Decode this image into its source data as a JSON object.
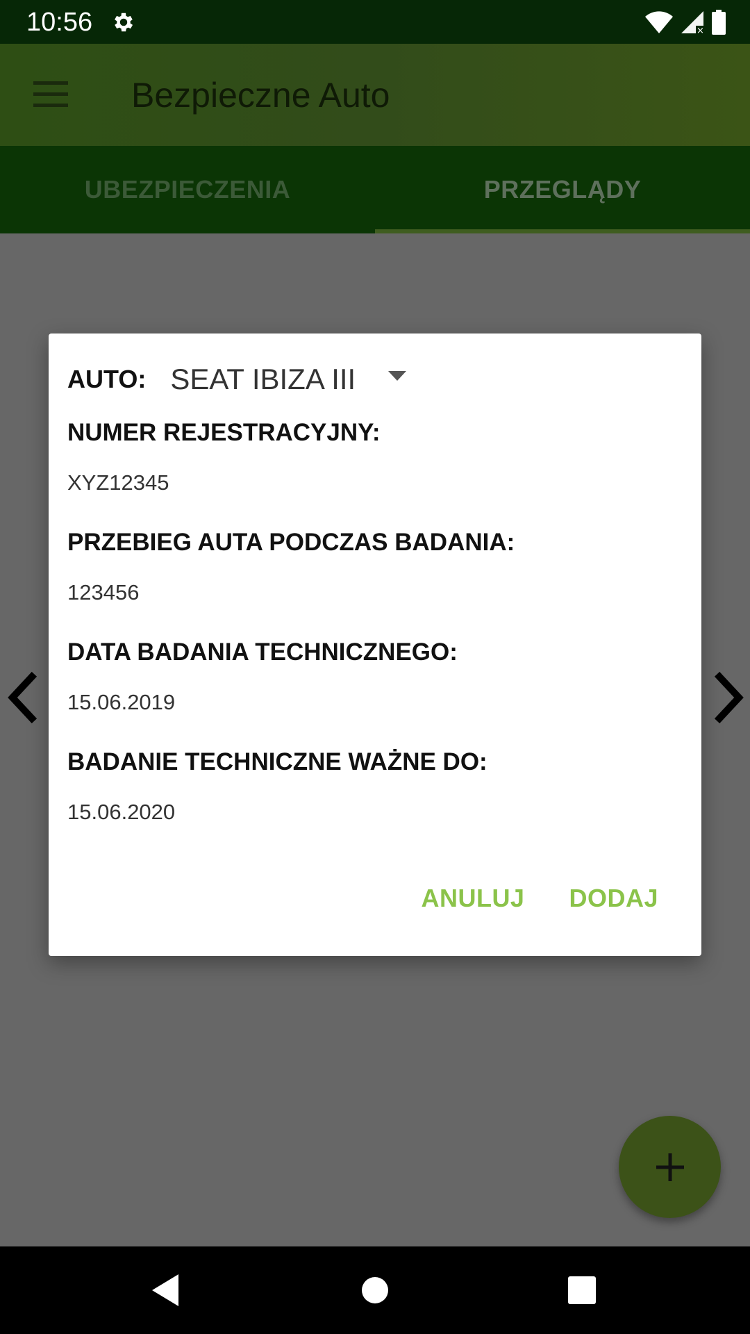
{
  "status_bar": {
    "time": "10:56",
    "icons": [
      "gear-icon",
      "wifi-icon",
      "signal-icon",
      "battery-icon"
    ]
  },
  "app_bar": {
    "title": "Bezpieczne Auto",
    "menu_icon": "hamburger-menu-icon"
  },
  "tabs": [
    {
      "label": "UBEZPIECZENIA",
      "selected": false
    },
    {
      "label": "PRZEGLĄDY",
      "selected": true
    }
  ],
  "dialog": {
    "auto_label": "AUTO:",
    "auto_value": "SEAT IBIZA III",
    "fields": [
      {
        "label": "NUMER REJESTRACYJNY:",
        "value": "XYZ12345"
      },
      {
        "label": "PRZEBIEG AUTA PODCZAS BADANIA:",
        "value": "123456"
      },
      {
        "label": "DATA BADANIA TECHNICZNEGO:",
        "value": "15.06.2019"
      },
      {
        "label": "BADANIE TECHNICZNE WAŻNE DO:",
        "value": "15.06.2020"
      }
    ],
    "buttons": {
      "cancel": "ANULUJ",
      "add": "DODAJ"
    }
  },
  "fab": {
    "icon": "plus-icon"
  },
  "nav_bar": {
    "icons": [
      "back-icon",
      "home-icon",
      "recents-icon"
    ]
  },
  "colors": {
    "status_bar": "#062706",
    "app_bar": "#324c1a",
    "tab_bar": "#0b3505",
    "accent": "#8bc34a",
    "scrim": "#676767",
    "fab": "#3c5218"
  }
}
